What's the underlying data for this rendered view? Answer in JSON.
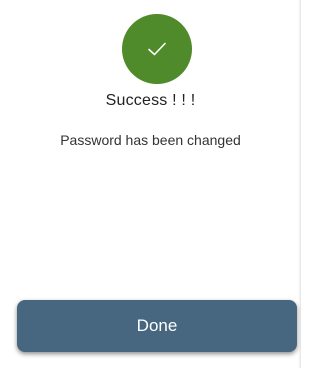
{
  "status": {
    "icon": "checkmark-icon",
    "color": "#4f8a2b"
  },
  "title": "Success ! ! !",
  "message": "Password has been changed",
  "button": {
    "label": "Done",
    "color": "#476680"
  }
}
